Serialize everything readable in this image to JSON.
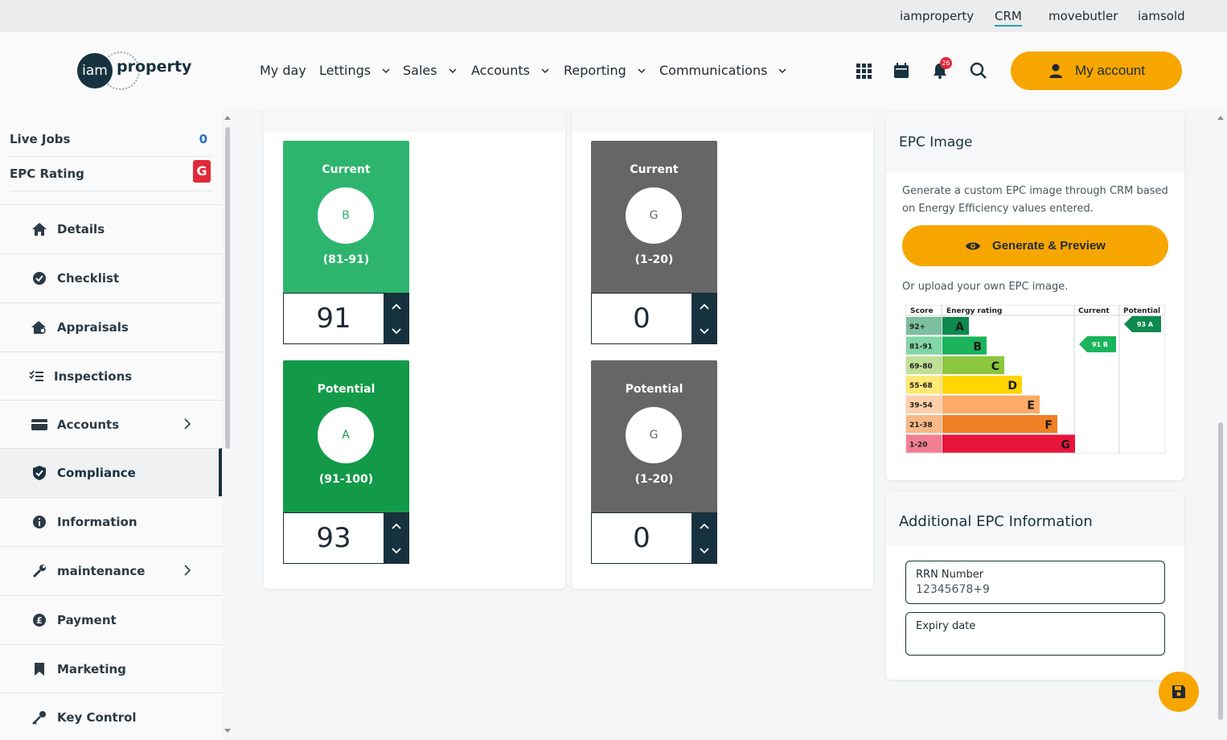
{
  "topbar": {
    "links": [
      "iamproperty",
      "CRM",
      "movebutler",
      "iamsold"
    ]
  },
  "header": {
    "logo_left": "iam",
    "logo_right": "property",
    "nav": [
      "My day",
      "Lettings",
      "Sales",
      "Accounts",
      "Reporting",
      "Communications"
    ],
    "notification_count": "26",
    "my_account_label": "My account"
  },
  "sidebar": {
    "live_jobs_label": "Live Jobs",
    "live_jobs_count": "0",
    "epc_rating_label": "EPC Rating",
    "epc_rating_value": "G",
    "items": [
      {
        "label": "Details",
        "icon": "home-icon"
      },
      {
        "label": "Checklist",
        "icon": "check-circle-icon"
      },
      {
        "label": "Appraisals",
        "icon": "house-search-icon"
      },
      {
        "label": "Inspections",
        "icon": "list-check-icon"
      },
      {
        "label": "Accounts",
        "icon": "card-icon"
      },
      {
        "label": "Compliance",
        "icon": "shield-check-icon"
      },
      {
        "label": "Information",
        "icon": "info-icon"
      },
      {
        "label": "maintenance",
        "icon": "wrench-icon"
      },
      {
        "label": "Payment",
        "icon": "pound-icon"
      },
      {
        "label": "Marketing",
        "icon": "bookmark-icon"
      },
      {
        "label": "Key Control",
        "icon": "key-icon"
      }
    ]
  },
  "energy_panel": {
    "current": {
      "label": "Current",
      "band": "B",
      "range": "(81-91)",
      "value": "91",
      "color": "#2db56e"
    },
    "potential": {
      "label": "Potential",
      "band": "A",
      "range": "(91-100)",
      "value": "93",
      "color": "#139a48"
    }
  },
  "environmental_panel": {
    "current": {
      "label": "Current",
      "band": "G",
      "range": "(1-20)",
      "value": "0",
      "color": "#666666"
    },
    "potential": {
      "label": "Potential",
      "band": "G",
      "range": "(1-20)",
      "value": "0",
      "color": "#666666"
    }
  },
  "epc_image": {
    "title": "EPC Image",
    "description": "Generate a custom EPC image through CRM based on Energy Efficiency values entered.",
    "generate_label": "Generate & Preview",
    "upload_text": "Or upload your own EPC image.",
    "chart": {
      "headers": [
        "Score",
        "Energy rating",
        "Current",
        "Potential"
      ],
      "bands": [
        {
          "score": "92+",
          "letter": "A",
          "color": "#0e8a4f"
        },
        {
          "score": "81-91",
          "letter": "B",
          "color": "#1bb35c"
        },
        {
          "score": "69-80",
          "letter": "C",
          "color": "#8dc63f"
        },
        {
          "score": "55-68",
          "letter": "D",
          "color": "#ffd500"
        },
        {
          "score": "39-54",
          "letter": "E",
          "color": "#fcaa65"
        },
        {
          "score": "21-38",
          "letter": "F",
          "color": "#ef8023"
        },
        {
          "score": "1-20",
          "letter": "G",
          "color": "#e9153b"
        }
      ],
      "current_marker": "91 B",
      "potential_marker": "93 A"
    }
  },
  "additional_epc": {
    "title": "Additional EPC Information",
    "rrn_label": "RRN Number",
    "rrn_value": "12345678+9",
    "expiry_label": "Expiry date",
    "expiry_value": ""
  },
  "colors": {
    "accent": "#f7a600",
    "navy": "#17323f",
    "alert": "#e02a3a"
  }
}
